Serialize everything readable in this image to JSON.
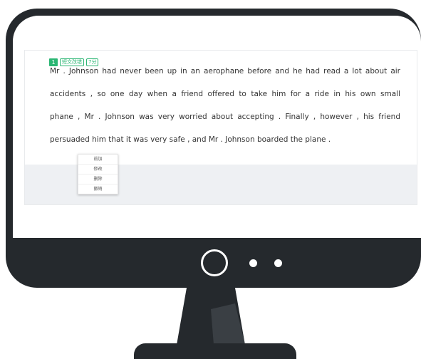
{
  "question": {
    "number": "1",
    "type_tag": "短文改错",
    "score_tag": "7分",
    "lines": [
      "Mr . Johnson had never been up in an aerophane before and he had read a lot about air",
      "accidents , so one day when a friend offered to take him for a ride in his own small",
      "phane , Mr . Johnson was very worried about accepting . Finally , however , his friend",
      "persuaded him that it was very safe , and Mr . Johnson boarded the plane ."
    ]
  },
  "context_menu": {
    "items": [
      {
        "label": "前加"
      },
      {
        "label": "修改"
      },
      {
        "label": "删除"
      },
      {
        "label": "撤销"
      }
    ]
  },
  "colors": {
    "bezel": "#25292d",
    "accent_green": "#2bb673",
    "text": "#333333",
    "panel_gray": "#eef0f3"
  },
  "icons": {
    "chin_button": "power-button-ring-icon",
    "chin_dots": "indicator-dot-icon"
  }
}
